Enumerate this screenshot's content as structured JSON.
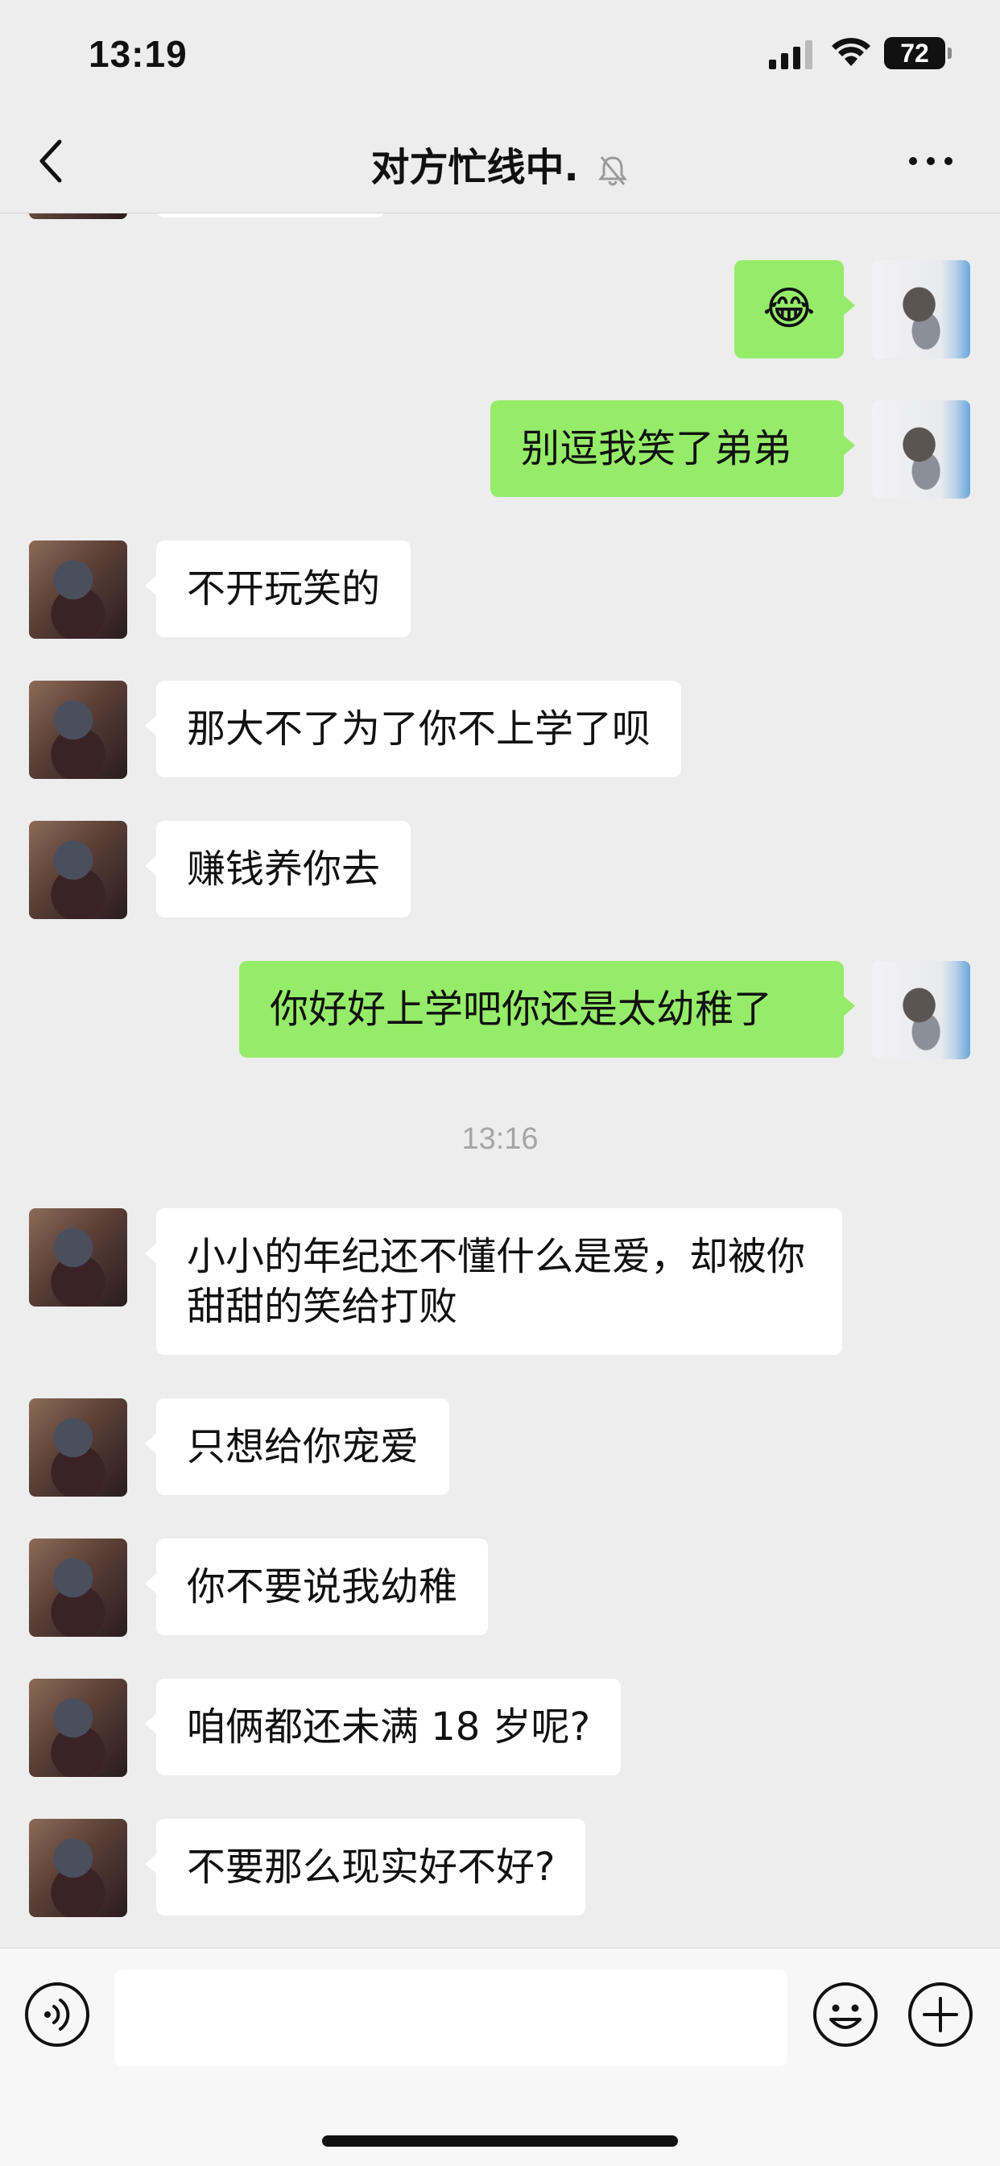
{
  "status_bar": {
    "time": "13:19",
    "battery": "72"
  },
  "nav": {
    "title": "对方忙线中."
  },
  "messages": [
    {
      "from": "self",
      "emoji": "😂"
    },
    {
      "from": "self",
      "text": "别逗我笑了弟弟"
    },
    {
      "from": "other",
      "text": "不开玩笑的"
    },
    {
      "from": "other",
      "text": "那大不了为了你不上学了呗"
    },
    {
      "from": "other",
      "text": "赚钱养你去"
    },
    {
      "from": "self",
      "text": "你好好上学吧你还是太幼稚了"
    },
    {
      "from": "other",
      "text": "小小的年纪还不懂什么是爱，却被你甜甜的笑给打败"
    },
    {
      "from": "other",
      "text": "只想给你宠爱"
    },
    {
      "from": "other",
      "text": "你不要说我幼稚"
    },
    {
      "from": "other",
      "text": "咱俩都还未满 18 岁呢?"
    },
    {
      "from": "other",
      "text": "不要那么现实好不好?"
    }
  ],
  "timestamp": "13:16",
  "input": {
    "value": ""
  },
  "colors": {
    "self_bubble": "#95ec69",
    "other_bubble": "#ffffff",
    "background": "#ededed"
  }
}
